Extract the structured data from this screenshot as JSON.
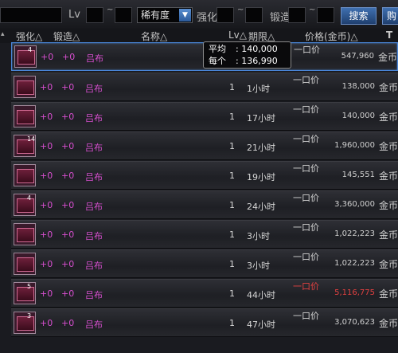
{
  "search": {
    "lv_label": "Lv",
    "tilde1": "~",
    "rarity_select": "稀有度",
    "enhance_label": "强化",
    "tilde2": "~",
    "forge_label": "锻造",
    "tilde3": "~",
    "search_button": "搜索",
    "buy_button": "购"
  },
  "headers": {
    "enhance": "强化△",
    "forge": "锻造△",
    "name": "名称△",
    "lv": "Lv△",
    "period": "期限△",
    "price": "价格(金币)△",
    "sort": "T"
  },
  "tooltip": {
    "avg_label": "平均",
    "avg_value": "140,000",
    "each_label": "每个",
    "each_value": "136,990"
  },
  "rows": [
    {
      "count": "4",
      "enhance": "+0",
      "forge": "+0",
      "name": "吕布",
      "lv": "",
      "period": "",
      "ykj": "一口价",
      "price": "547,960",
      "currency": "金币",
      "red": false
    },
    {
      "count": "",
      "enhance": "+0",
      "forge": "+0",
      "name": "吕布",
      "lv": "1",
      "period": "1小时",
      "ykj": "一口价",
      "price": "138,000",
      "currency": "金币",
      "red": false
    },
    {
      "count": "",
      "enhance": "+0",
      "forge": "+0",
      "name": "吕布",
      "lv": "1",
      "period": "17小时",
      "ykj": "一口价",
      "price": "140,000",
      "currency": "金币",
      "red": false
    },
    {
      "count": "14",
      "enhance": "+0",
      "forge": "+0",
      "name": "吕布",
      "lv": "1",
      "period": "21小时",
      "ykj": "一口价",
      "price": "1,960,000",
      "currency": "金币",
      "red": false
    },
    {
      "count": "",
      "enhance": "+0",
      "forge": "+0",
      "name": "吕布",
      "lv": "1",
      "period": "19小时",
      "ykj": "一口价",
      "price": "145,551",
      "currency": "金币",
      "red": false
    },
    {
      "count": "4",
      "enhance": "+0",
      "forge": "+0",
      "name": "吕布",
      "lv": "1",
      "period": "24小时",
      "ykj": "一口价",
      "price": "3,360,000",
      "currency": "金币",
      "red": false
    },
    {
      "count": "",
      "enhance": "+0",
      "forge": "+0",
      "name": "吕布",
      "lv": "1",
      "period": "3小时",
      "ykj": "一口价",
      "price": "1,022,223",
      "currency": "金币",
      "red": false
    },
    {
      "count": "",
      "enhance": "+0",
      "forge": "+0",
      "name": "吕布",
      "lv": "1",
      "period": "3小时",
      "ykj": "一口价",
      "price": "1,022,223",
      "currency": "金币",
      "red": false
    },
    {
      "count": "5",
      "enhance": "+0",
      "forge": "+0",
      "name": "吕布",
      "lv": "1",
      "period": "44小时",
      "ykj": "一口价",
      "price": "5,116,775",
      "currency": "金币",
      "red": true
    },
    {
      "count": "3",
      "enhance": "+0",
      "forge": "+0",
      "name": "吕布",
      "lv": "1",
      "period": "47小时",
      "ykj": "一口价",
      "price": "3,070,623",
      "currency": "金币",
      "red": false
    }
  ]
}
